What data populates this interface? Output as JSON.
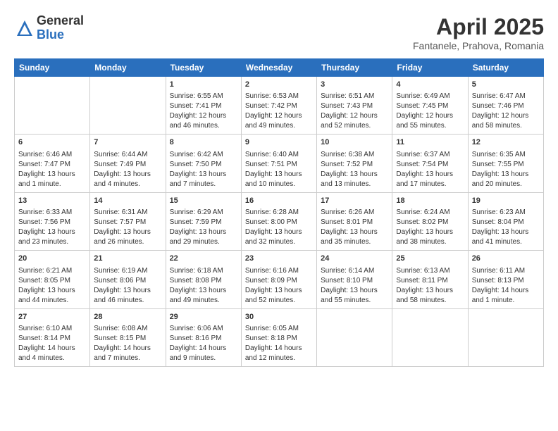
{
  "logo": {
    "general": "General",
    "blue": "Blue"
  },
  "title": "April 2025",
  "subtitle": "Fantanele, Prahova, Romania",
  "days_of_week": [
    "Sunday",
    "Monday",
    "Tuesday",
    "Wednesday",
    "Thursday",
    "Friday",
    "Saturday"
  ],
  "weeks": [
    [
      {
        "day": "",
        "content": ""
      },
      {
        "day": "",
        "content": ""
      },
      {
        "day": "1",
        "content": "Sunrise: 6:55 AM\nSunset: 7:41 PM\nDaylight: 12 hours and 46 minutes."
      },
      {
        "day": "2",
        "content": "Sunrise: 6:53 AM\nSunset: 7:42 PM\nDaylight: 12 hours and 49 minutes."
      },
      {
        "day": "3",
        "content": "Sunrise: 6:51 AM\nSunset: 7:43 PM\nDaylight: 12 hours and 52 minutes."
      },
      {
        "day": "4",
        "content": "Sunrise: 6:49 AM\nSunset: 7:45 PM\nDaylight: 12 hours and 55 minutes."
      },
      {
        "day": "5",
        "content": "Sunrise: 6:47 AM\nSunset: 7:46 PM\nDaylight: 12 hours and 58 minutes."
      }
    ],
    [
      {
        "day": "6",
        "content": "Sunrise: 6:46 AM\nSunset: 7:47 PM\nDaylight: 13 hours and 1 minute."
      },
      {
        "day": "7",
        "content": "Sunrise: 6:44 AM\nSunset: 7:49 PM\nDaylight: 13 hours and 4 minutes."
      },
      {
        "day": "8",
        "content": "Sunrise: 6:42 AM\nSunset: 7:50 PM\nDaylight: 13 hours and 7 minutes."
      },
      {
        "day": "9",
        "content": "Sunrise: 6:40 AM\nSunset: 7:51 PM\nDaylight: 13 hours and 10 minutes."
      },
      {
        "day": "10",
        "content": "Sunrise: 6:38 AM\nSunset: 7:52 PM\nDaylight: 13 hours and 13 minutes."
      },
      {
        "day": "11",
        "content": "Sunrise: 6:37 AM\nSunset: 7:54 PM\nDaylight: 13 hours and 17 minutes."
      },
      {
        "day": "12",
        "content": "Sunrise: 6:35 AM\nSunset: 7:55 PM\nDaylight: 13 hours and 20 minutes."
      }
    ],
    [
      {
        "day": "13",
        "content": "Sunrise: 6:33 AM\nSunset: 7:56 PM\nDaylight: 13 hours and 23 minutes."
      },
      {
        "day": "14",
        "content": "Sunrise: 6:31 AM\nSunset: 7:57 PM\nDaylight: 13 hours and 26 minutes."
      },
      {
        "day": "15",
        "content": "Sunrise: 6:29 AM\nSunset: 7:59 PM\nDaylight: 13 hours and 29 minutes."
      },
      {
        "day": "16",
        "content": "Sunrise: 6:28 AM\nSunset: 8:00 PM\nDaylight: 13 hours and 32 minutes."
      },
      {
        "day": "17",
        "content": "Sunrise: 6:26 AM\nSunset: 8:01 PM\nDaylight: 13 hours and 35 minutes."
      },
      {
        "day": "18",
        "content": "Sunrise: 6:24 AM\nSunset: 8:02 PM\nDaylight: 13 hours and 38 minutes."
      },
      {
        "day": "19",
        "content": "Sunrise: 6:23 AM\nSunset: 8:04 PM\nDaylight: 13 hours and 41 minutes."
      }
    ],
    [
      {
        "day": "20",
        "content": "Sunrise: 6:21 AM\nSunset: 8:05 PM\nDaylight: 13 hours and 44 minutes."
      },
      {
        "day": "21",
        "content": "Sunrise: 6:19 AM\nSunset: 8:06 PM\nDaylight: 13 hours and 46 minutes."
      },
      {
        "day": "22",
        "content": "Sunrise: 6:18 AM\nSunset: 8:08 PM\nDaylight: 13 hours and 49 minutes."
      },
      {
        "day": "23",
        "content": "Sunrise: 6:16 AM\nSunset: 8:09 PM\nDaylight: 13 hours and 52 minutes."
      },
      {
        "day": "24",
        "content": "Sunrise: 6:14 AM\nSunset: 8:10 PM\nDaylight: 13 hours and 55 minutes."
      },
      {
        "day": "25",
        "content": "Sunrise: 6:13 AM\nSunset: 8:11 PM\nDaylight: 13 hours and 58 minutes."
      },
      {
        "day": "26",
        "content": "Sunrise: 6:11 AM\nSunset: 8:13 PM\nDaylight: 14 hours and 1 minute."
      }
    ],
    [
      {
        "day": "27",
        "content": "Sunrise: 6:10 AM\nSunset: 8:14 PM\nDaylight: 14 hours and 4 minutes."
      },
      {
        "day": "28",
        "content": "Sunrise: 6:08 AM\nSunset: 8:15 PM\nDaylight: 14 hours and 7 minutes."
      },
      {
        "day": "29",
        "content": "Sunrise: 6:06 AM\nSunset: 8:16 PM\nDaylight: 14 hours and 9 minutes."
      },
      {
        "day": "30",
        "content": "Sunrise: 6:05 AM\nSunset: 8:18 PM\nDaylight: 14 hours and 12 minutes."
      },
      {
        "day": "",
        "content": ""
      },
      {
        "day": "",
        "content": ""
      },
      {
        "day": "",
        "content": ""
      }
    ]
  ]
}
